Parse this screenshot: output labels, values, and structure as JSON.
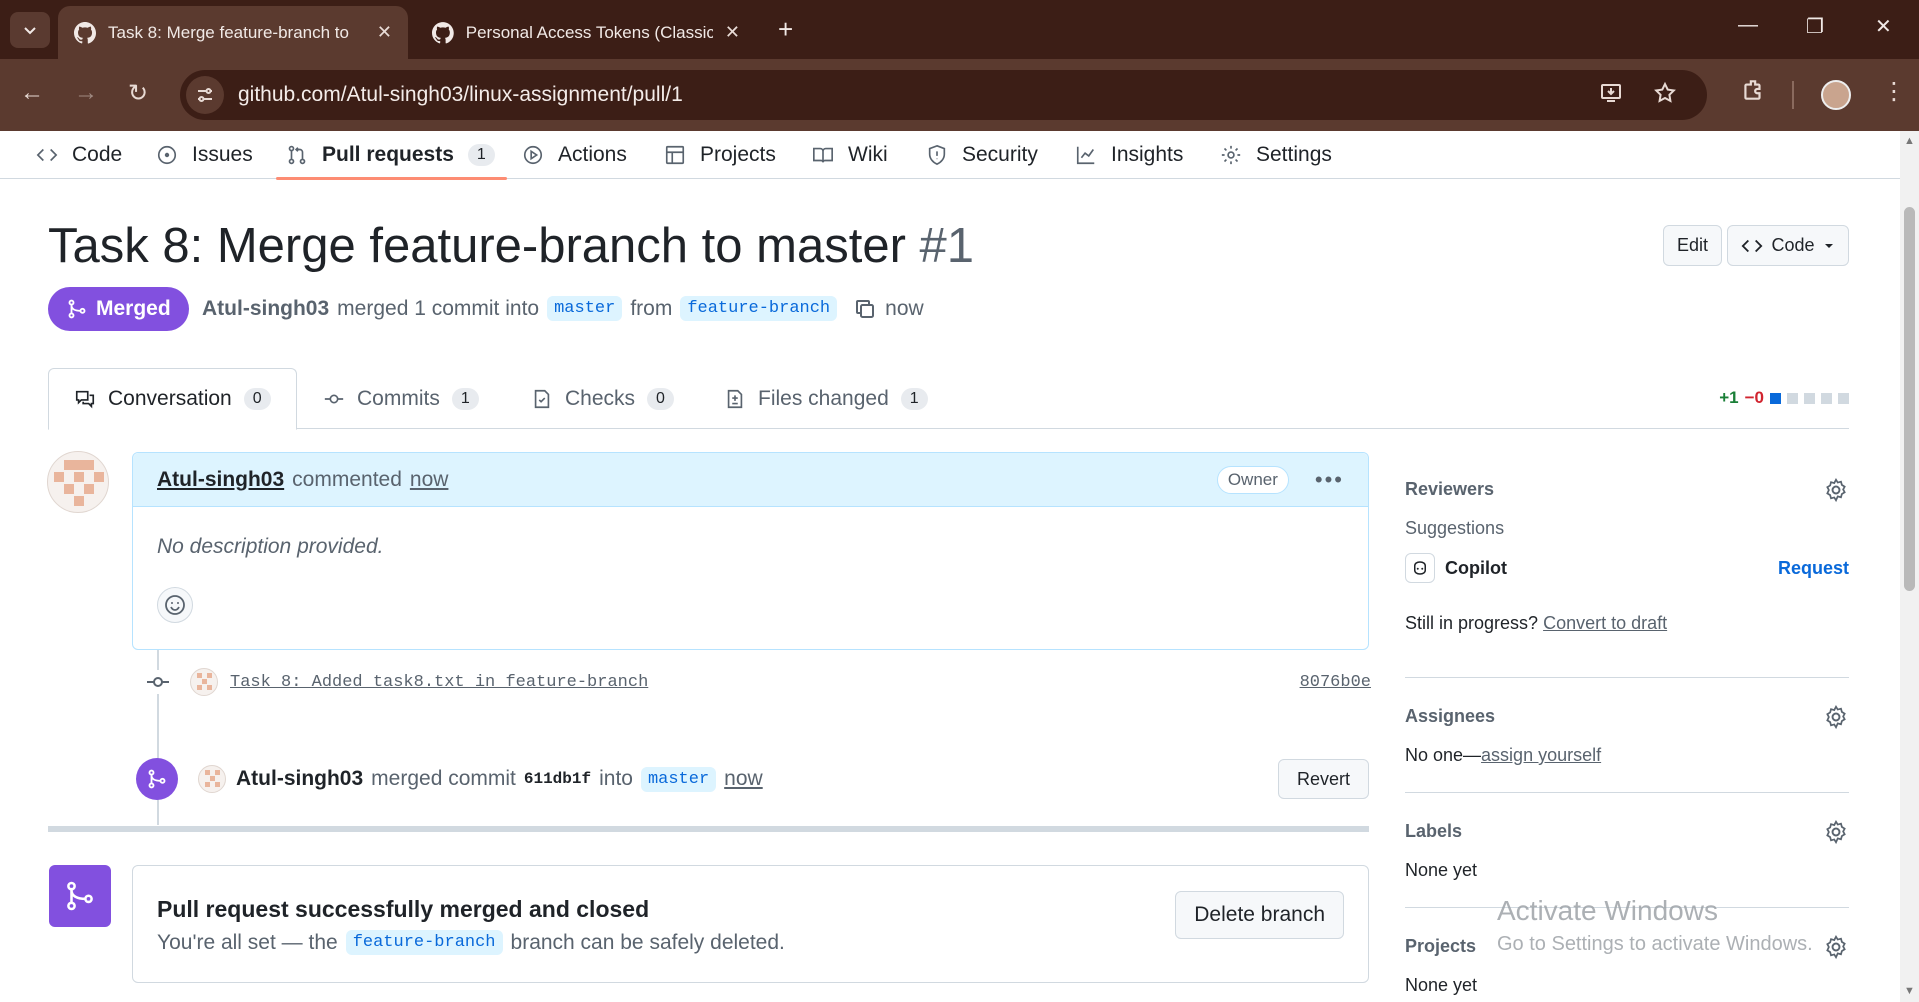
{
  "browser": {
    "tabs": [
      {
        "title": "Task 8: Merge feature-branch to",
        "active": true
      },
      {
        "title": "Personal Access Tokens (Classic",
        "active": false
      }
    ],
    "url": "github.com/Atul-singh03/linux-assignment/pull/1"
  },
  "repo_nav": {
    "code": "Code",
    "issues": "Issues",
    "pull_requests": "Pull requests",
    "pull_requests_count": "1",
    "actions": "Actions",
    "projects": "Projects",
    "wiki": "Wiki",
    "security": "Security",
    "insights": "Insights",
    "settings": "Settings"
  },
  "pr": {
    "title": "Task 8: Merge feature-branch to master",
    "number": "#1",
    "edit_label": "Edit",
    "code_label": "Code",
    "state": "Merged",
    "author": "Atul-singh03",
    "merged_text": "merged 1 commit into",
    "base_branch": "master",
    "from_text": "from",
    "head_branch": "feature-branch",
    "time": "now"
  },
  "pr_tabs": {
    "conversation": "Conversation",
    "conversation_count": "0",
    "commits": "Commits",
    "commits_count": "1",
    "checks": "Checks",
    "checks_count": "0",
    "files_changed": "Files changed",
    "files_changed_count": "1",
    "additions": "+1",
    "deletions": "−0"
  },
  "comment": {
    "author": "Atul-singh03",
    "action": "commented",
    "time": "now",
    "role": "Owner",
    "body": "No description provided."
  },
  "commit": {
    "message": "Task 8: Added task8.txt in feature-branch",
    "sha": "8076b0e"
  },
  "merge_event": {
    "author": "Atul-singh03",
    "action": "merged commit",
    "sha": "611db1f",
    "into": "into",
    "branch": "master",
    "time": "now",
    "revert_label": "Revert"
  },
  "merged_box": {
    "title": "Pull request successfully merged and closed",
    "sub_prefix": "You're all set — the",
    "branch": "feature-branch",
    "sub_suffix": "branch can be safely deleted.",
    "delete_label": "Delete branch"
  },
  "sidebar": {
    "reviewers": "Reviewers",
    "suggestions": "Suggestions",
    "copilot": "Copilot",
    "request": "Request",
    "still_in_progress": "Still in progress?",
    "convert_to_draft": "Convert to draft",
    "assignees": "Assignees",
    "no_one": "No one—",
    "assign_yourself": "assign yourself",
    "labels": "Labels",
    "labels_none": "None yet",
    "projects": "Projects",
    "projects_none": "None yet"
  },
  "watermark": {
    "line1": "Activate Windows",
    "line2": "Go to Settings to activate Windows."
  },
  "colors": {
    "merged_purple": "#8250df",
    "link_blue": "#0969da",
    "tab_underline": "#fd8c73",
    "chrome_dark": "#3c1e16",
    "chrome_toolbar": "#5b3a2f"
  }
}
